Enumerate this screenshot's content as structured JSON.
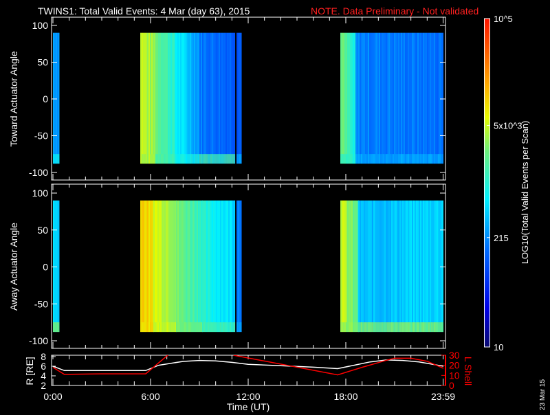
{
  "chart_data": {
    "type": "heatmap",
    "title": "TWINS1: Total Valid Events:  4 Mar (day  63), 2015",
    "note": "NOTE. Data Preliminary - Not validated",
    "colors": {
      "note": "#ff2020",
      "lshell": "#ff0000",
      "radius": "#ffffff",
      "background": "#000000"
    },
    "xlabel": "Time (UT)",
    "xlim_hours": [
      0,
      24
    ],
    "x_ticks": [
      {
        "h": 0,
        "label": "0:00"
      },
      {
        "h": 6,
        "label": "6:00"
      },
      {
        "h": 12,
        "label": "12:00"
      },
      {
        "h": 18,
        "label": "18:00"
      },
      {
        "h": 23.98,
        "label": "23:59"
      }
    ],
    "colorbar": {
      "label": "LOG10(Total Valid Events per Scan)",
      "range": [
        10,
        100000
      ],
      "scale": "log",
      "ticks": [
        {
          "v": 100000,
          "label": "10^5"
        },
        {
          "v": 5000,
          "label": "5x10^3"
        },
        {
          "v": 215,
          "label": "215"
        },
        {
          "v": 10,
          "label": "10"
        }
      ]
    },
    "panels": [
      {
        "ylabel": "Toward Actuator Angle",
        "ylim": [
          -110,
          110
        ],
        "y_ticks": [
          100,
          50,
          0,
          -50,
          -100
        ],
        "data_angle_range": [
          -88,
          90
        ],
        "segments": [
          {
            "t0": 0.0,
            "t1": 0.4,
            "v0": 300,
            "v1": 260,
            "edge": 700
          },
          {
            "t0": 5.4,
            "t1": 6.3,
            "v0": 5000,
            "v1": 3000,
            "edge": 4000
          },
          {
            "t0": 6.3,
            "t1": 7.5,
            "v0": 2500,
            "v1": 900,
            "edge": 1500
          },
          {
            "t0": 7.5,
            "t1": 9.0,
            "v0": 700,
            "v1": 250,
            "edge": 800
          },
          {
            "t0": 9.0,
            "t1": 11.2,
            "v0": 180,
            "v1": 130,
            "edge": 1500
          },
          {
            "t0": 11.3,
            "t1": 11.6,
            "v0": 120,
            "v1": 120,
            "edge": 300
          },
          {
            "t0": 17.7,
            "t1": 18.6,
            "v0": 2500,
            "v1": 600,
            "edge": 1000
          },
          {
            "t0": 18.6,
            "t1": 24.0,
            "v0": 200,
            "v1": 160,
            "edge": 300
          }
        ]
      },
      {
        "ylabel": "Away Actuator Angle",
        "ylim": [
          -110,
          110
        ],
        "y_ticks": [
          100,
          50,
          0,
          -50,
          -100
        ],
        "data_angle_range": [
          -88,
          90
        ],
        "segments": [
          {
            "t0": 0.0,
            "t1": 0.4,
            "v0": 600,
            "v1": 350,
            "edge": 3000
          },
          {
            "t0": 5.4,
            "t1": 6.2,
            "v0": 12000,
            "v1": 7000,
            "edge": 9000
          },
          {
            "t0": 6.2,
            "t1": 7.6,
            "v0": 6000,
            "v1": 3500,
            "edge": 5000
          },
          {
            "t0": 7.6,
            "t1": 9.2,
            "v0": 2500,
            "v1": 1200,
            "edge": 2500
          },
          {
            "t0": 9.2,
            "t1": 11.2,
            "v0": 900,
            "v1": 500,
            "edge": 1500
          },
          {
            "t0": 11.3,
            "t1": 11.6,
            "v0": 200,
            "v1": 200,
            "edge": 300
          },
          {
            "t0": 17.7,
            "t1": 18.8,
            "v0": 5000,
            "v1": 1500,
            "edge": 3000
          },
          {
            "t0": 18.8,
            "t1": 24.0,
            "v0": 350,
            "v1": 500,
            "edge": 3000
          }
        ]
      }
    ],
    "orbit": {
      "left_label": "R [RE]",
      "right_label": "L Shell",
      "r_ticks": [
        2,
        4,
        6,
        8
      ],
      "l_ticks": [
        0,
        10,
        20,
        30
      ],
      "r_lim": [
        1.5,
        8.2
      ],
      "l_lim": [
        0,
        31
      ],
      "radius": {
        "t": [
          0,
          0.7,
          5.7,
          6.5,
          8,
          9,
          10,
          11,
          12,
          14,
          16,
          17.5,
          18.5,
          19.5,
          20.5,
          21.5,
          22.5,
          24
        ],
        "v": [
          6,
          5.1,
          5.1,
          6.2,
          7,
          7.2,
          7.1,
          6.8,
          6.4,
          6.1,
          5.8,
          5.5,
          6.2,
          6.9,
          7.3,
          7.2,
          6.9,
          6.0
        ]
      },
      "lshell_a": {
        "t": [
          0,
          0.7,
          3,
          5.7,
          7.2
        ],
        "v": [
          18,
          11,
          11.5,
          11.5,
          32
        ]
      },
      "lshell_b": {
        "t": [
          11.1,
          17.5,
          19,
          20.5,
          21,
          22,
          23,
          24
        ],
        "v": [
          30,
          10.5,
          18,
          25,
          27,
          27,
          24,
          17
        ]
      }
    },
    "date_stamp": "23 Mar 15"
  }
}
